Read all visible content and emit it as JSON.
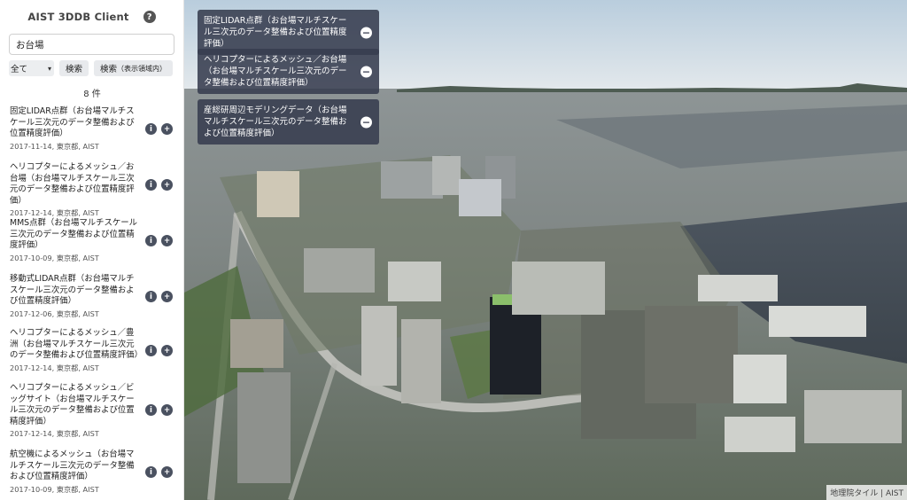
{
  "app": {
    "title": "AIST 3DDB Client",
    "help_icon": "?"
  },
  "search": {
    "value": "お台場",
    "placeholder": ""
  },
  "filter": {
    "selected": "全て"
  },
  "buttons": {
    "search": "検索",
    "search_area": "検索",
    "search_area_suffix": "（表示領域内）"
  },
  "result_count": "8 件",
  "results": [
    {
      "title": "固定LIDAR点群（お台場マルチスケール三次元のデータ整備および位置精度評価）",
      "meta": "2017-11-14, 東京都, AIST"
    },
    {
      "title": "ヘリコプターによるメッシュ／お台場（お台場マルチスケール三次元のデータ整備および位置精度評価）",
      "meta": "2017-12-14, 東京都, AIST"
    },
    {
      "title": "MMS点群（お台場マルチスケール三次元のデータ整備および位置精度評価）",
      "meta": "2017-10-09, 東京都, AIST"
    },
    {
      "title": "移動式LIDAR点群（お台場マルチスケール三次元のデータ整備および位置精度評価）",
      "meta": "2017-12-06, 東京都, AIST"
    },
    {
      "title": "ヘリコプターによるメッシュ／豊洲（お台場マルチスケール三次元のデータ整備および位置精度評価）",
      "meta": "2017-12-14, 東京都, AIST"
    },
    {
      "title": "ヘリコプターによるメッシュ／ビッグサイト（お台場マルチスケール三次元のデータ整備および位置精度評価）",
      "meta": "2017-12-14, 東京都, AIST"
    },
    {
      "title": "航空機によるメッシュ（お台場マルチスケール三次元のデータ整備および位置精度評価）",
      "meta": "2017-10-09, 東京都, AIST"
    }
  ],
  "result_icons": {
    "info": "i",
    "add": "+"
  },
  "active_layers": [
    {
      "title": "固定LIDAR点群（お台場マルチスケール三次元のデータ整備および位置精度評価）"
    },
    {
      "title": "ヘリコプターによるメッシュ／お台場（お台場マルチスケール三次元のデータ整備および位置精度評価）"
    },
    {
      "title": "産総研周辺モデリングデータ（お台場マルチスケール三次元のデータ整備および位置精度評価）"
    }
  ],
  "remove_icon": "−",
  "attribution": "地理院タイル | AIST"
}
